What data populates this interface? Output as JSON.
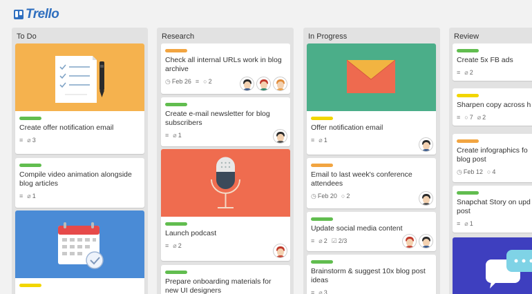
{
  "app": {
    "logo_text": "Trello"
  },
  "colors": {
    "green": "#61bd4f",
    "orange": "#f2a541",
    "yellow": "#f2d600",
    "cover_todo_1": "#f5b24e",
    "cover_todo_3": "#4a8bd6",
    "cover_research_3": "#ef6c4f",
    "cover_progress_1": "#4bae89",
    "cover_review_5": "#3e3fbf"
  },
  "lists": [
    {
      "title": "To Do",
      "cards": [
        {
          "cover": "document-pen-illustration",
          "label": "green",
          "title": "Create offer notification email",
          "badges": {
            "description": true,
            "attachments": "3"
          }
        },
        {
          "label": "green",
          "title": "Compile video animation alongside blog articles",
          "badges": {
            "description": true,
            "attachments": "1"
          }
        },
        {
          "cover": "calendar-illustration",
          "label": "yellow",
          "title": ""
        }
      ]
    },
    {
      "title": "Research",
      "cards": [
        {
          "label": "orange",
          "title": "Check all internal URLs work in blog archive",
          "badges": {
            "due": "Feb 26",
            "description": true,
            "comments": "2"
          },
          "avatars": [
            "avatar-man-dark-hair",
            "avatar-woman-red-hair",
            "avatar-man-orange-hair"
          ]
        },
        {
          "label": "green",
          "title": "Create e-mail newsletter for blog subscribers",
          "badges": {
            "description": true,
            "attachments": "1"
          },
          "avatars": [
            "avatar-man-glasses"
          ]
        },
        {
          "cover": "microphone-illustration",
          "label": "green",
          "title": "Launch podcast",
          "badges": {
            "description": true,
            "attachments": "2"
          },
          "avatars": [
            "avatar-woman-red-hair"
          ]
        },
        {
          "label": "green",
          "title": "Prepare onboarding materials for new UI designers"
        }
      ]
    },
    {
      "title": "In Progress",
      "cards": [
        {
          "cover": "envelope-illustration",
          "label": "yellow",
          "title": "Offer notification email",
          "badges": {
            "description": true,
            "attachments": "1"
          },
          "avatars": [
            "avatar-man-dark-hair"
          ]
        },
        {
          "label": "orange",
          "title": "Email to last week's conference attendees",
          "badges": {
            "due": "Feb 20",
            "comments": "2"
          },
          "avatars": [
            "avatar-man-glasses"
          ]
        },
        {
          "label": "green",
          "title": "Update social media content",
          "badges": {
            "description": true,
            "attachments": "2",
            "checklist": "2/3"
          },
          "avatars": [
            "avatar-woman-red-hair",
            "avatar-man-dark-hair"
          ]
        },
        {
          "label": "green",
          "title": "Brainstorm & suggest 10x blog post ideas",
          "badges": {
            "description": true,
            "attachments": "3"
          }
        }
      ]
    },
    {
      "title": "Review",
      "cards": [
        {
          "label": "green",
          "title": "Create 5x FB ads",
          "badges": {
            "description": true,
            "attachments": "2"
          }
        },
        {
          "label": "yellow",
          "title": "Sharpen copy across h",
          "badges": {
            "description": true,
            "comments": "7",
            "attachments": "2"
          }
        },
        {
          "label": "orange",
          "title": "Create infographics fo blog post",
          "badges": {
            "due": "Feb 12",
            "comments": "4"
          }
        },
        {
          "label": "green",
          "title": "Snapchat Story on upd post",
          "badges": {
            "description": true,
            "attachments": "1"
          }
        },
        {
          "cover": "chat-bubbles-illustration"
        }
      ]
    }
  ]
}
